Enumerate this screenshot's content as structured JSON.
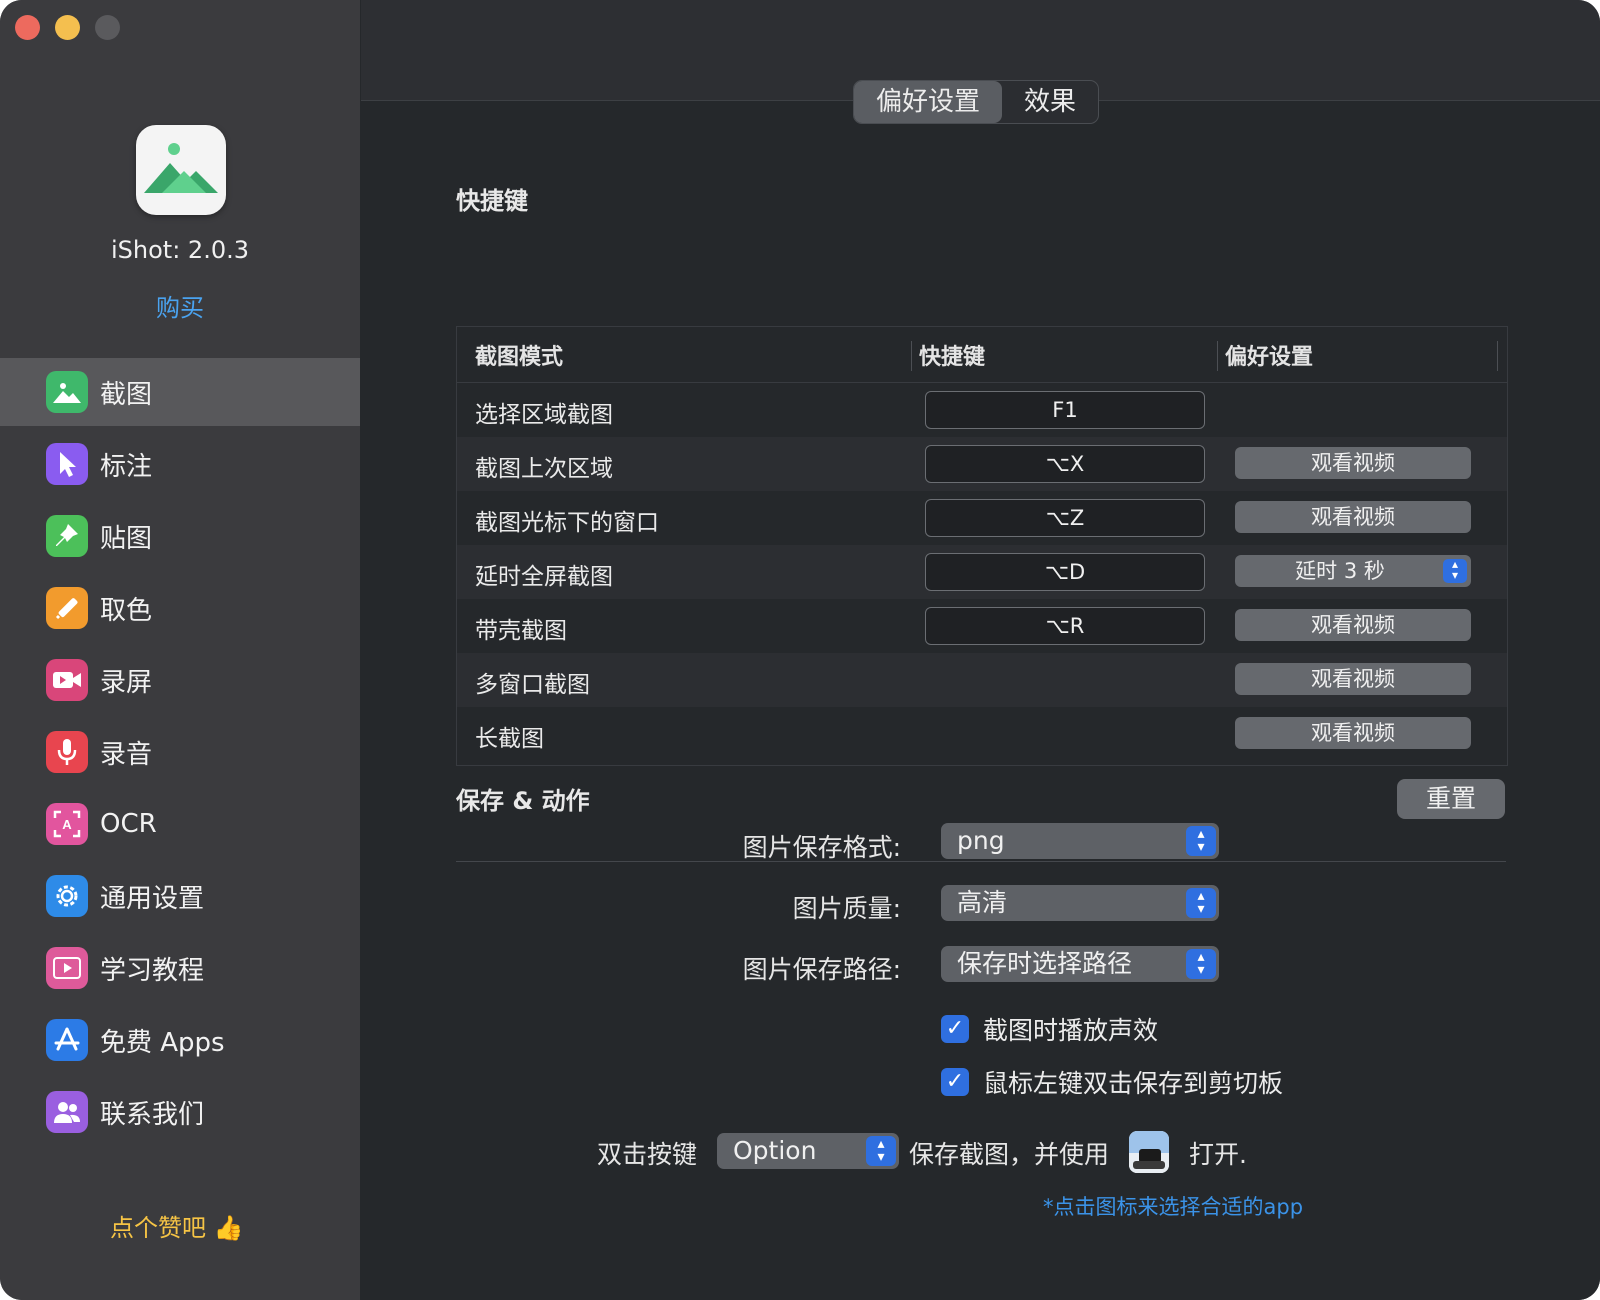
{
  "app": {
    "version_label": "iShot: 2.0.3",
    "buy_label": "购买",
    "like_label": "点个赞吧 👍"
  },
  "sidebar": {
    "items": [
      {
        "label": "截图",
        "icon": "screenshot-icon",
        "color": "#3fb86b",
        "active": true
      },
      {
        "label": "标注",
        "icon": "annotate-cursor-icon",
        "color": "#8a5cf0"
      },
      {
        "label": "贴图",
        "icon": "pin-icon",
        "color": "#4cc05a"
      },
      {
        "label": "取色",
        "icon": "color-picker-icon",
        "color": "#f29b2d"
      },
      {
        "label": "录屏",
        "icon": "screen-record-icon",
        "color": "#d9467a"
      },
      {
        "label": "录音",
        "icon": "microphone-icon",
        "color": "#e8454f"
      },
      {
        "label": "OCR",
        "icon": "ocr-icon",
        "color": "#e2559e"
      },
      {
        "label": "通用设置",
        "icon": "gear-icon",
        "color": "#2e8be8"
      },
      {
        "label": "学习教程",
        "icon": "tutorial-video-icon",
        "color": "#de5a9a"
      },
      {
        "label": "免费 Apps",
        "icon": "app-store-icon",
        "color": "#2c7be6"
      },
      {
        "label": "联系我们",
        "icon": "contacts-icon",
        "color": "#9a5fe0"
      }
    ]
  },
  "tabs": [
    {
      "label": "偏好设置",
      "active": true
    },
    {
      "label": "效果",
      "active": false
    }
  ],
  "shortcuts": {
    "title": "快捷键",
    "columns": [
      "截图模式",
      "快捷键",
      "偏好设置"
    ],
    "rows": [
      {
        "mode": "选择区域截图",
        "key": "F1",
        "pref": ""
      },
      {
        "mode": "截图上次区域",
        "key": "⌥X",
        "pref": "观看视频"
      },
      {
        "mode": "截图光标下的窗口",
        "key": "⌥Z",
        "pref": "观看视频"
      },
      {
        "mode": "延时全屏截图",
        "key": "⌥D",
        "pref": "延时 3 秒",
        "pref_type": "select"
      },
      {
        "mode": "带壳截图",
        "key": "⌥R",
        "pref": "观看视频"
      },
      {
        "mode": "多窗口截图",
        "key": "",
        "pref": "观看视频"
      },
      {
        "mode": "长截图",
        "key": "",
        "pref": "观看视频"
      }
    ],
    "reset_label": "重置"
  },
  "save": {
    "title": "保存 & 动作",
    "format_label": "图片保存格式:",
    "format_value": "png",
    "quality_label": "图片质量:",
    "quality_value": "高清",
    "path_label": "图片保存路径:",
    "path_value": "保存时选择路径",
    "checkbox_sound": "截图时播放声效",
    "checkbox_sound_checked": true,
    "checkbox_clipboard": "鼠标左键双击保存到剪切板",
    "checkbox_clipboard_checked": true,
    "double_click_label": "双击按键",
    "double_click_value": "Option",
    "save_and_open_text": "保存截图，并使用",
    "open_text": "打开.",
    "hint": "*点击图标来选择合适的app"
  },
  "colors": {
    "accent_blue": "#2f6fe0",
    "link_blue": "#4aa3f0",
    "like_yellow": "#f6c445"
  }
}
